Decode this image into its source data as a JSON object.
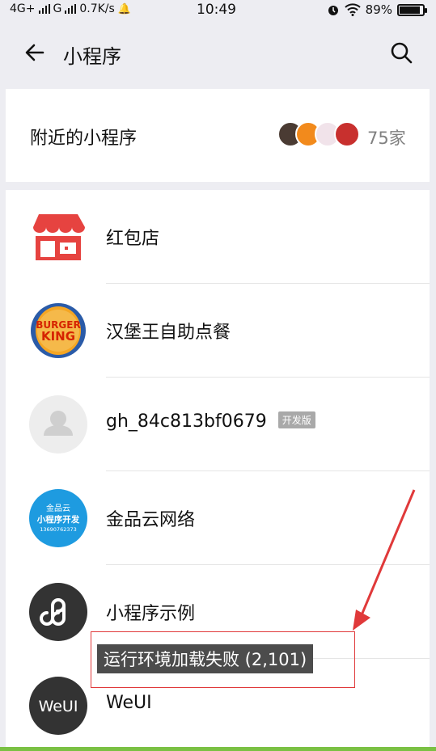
{
  "status_bar": {
    "network": "4G+",
    "network2": "G",
    "speed": "0.7K/s",
    "time": "10:49",
    "battery": "89%",
    "battery_level": 0.89
  },
  "nav": {
    "title": "小程序",
    "back_icon": "arrow-left-icon",
    "search_icon": "search-icon"
  },
  "nearby": {
    "label": "附近的小程序",
    "count": "75家"
  },
  "list": {
    "items": [
      {
        "label": "红包店",
        "icon": "shop-icon"
      },
      {
        "label": "汉堡王自助点餐",
        "icon": "burger-king-logo"
      },
      {
        "label": "gh_84c813bf0679",
        "tag": "开发版",
        "icon": "default-avatar-icon"
      },
      {
        "label": "金品云网络",
        "icon": "jinpinyun-logo",
        "icon_text_top": "金品云",
        "icon_text_mid": "小程序开发",
        "icon_text_bottom": "13690762373"
      },
      {
        "label": "小程序示例",
        "icon": "mini-program-icon"
      },
      {
        "label": "WeUI",
        "icon": "weui-logo",
        "icon_text": "WeUI"
      }
    ]
  },
  "toast": "运行环境加载失败 (2,101)",
  "colors": {
    "annotation": "#E0393A",
    "shop_red": "#E64340",
    "burger_blue": "#2A5BA8",
    "jinpin_blue": "#1E9BE0",
    "dark_icon": "#333333"
  }
}
